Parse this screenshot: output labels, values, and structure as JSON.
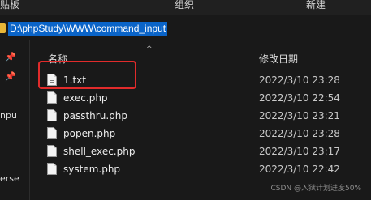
{
  "ribbon": {
    "items": [
      "贴板",
      "组织",
      "新建"
    ]
  },
  "address": {
    "path": "D:\\phpStudy\\WWW\\command_input"
  },
  "nav": {
    "pins": [
      "📌",
      "📌"
    ],
    "labels": [
      "npu",
      "erse"
    ]
  },
  "columns": {
    "name": "名称",
    "modified": "修改日期",
    "sort_arrow": "^"
  },
  "files": [
    {
      "name": "1.txt",
      "modified": "2022/3/10 23:28",
      "type": "txt"
    },
    {
      "name": "exec.php",
      "modified": "2022/3/10 22:54",
      "type": "php"
    },
    {
      "name": "passthru.php",
      "modified": "2022/3/10 23:21",
      "type": "php"
    },
    {
      "name": "popen.php",
      "modified": "2022/3/10 23:28",
      "type": "php"
    },
    {
      "name": "shell_exec.php",
      "modified": "2022/3/10 23:17",
      "type": "php"
    },
    {
      "name": "system.php",
      "modified": "2022/3/10 22:42",
      "type": "php"
    }
  ],
  "watermark": "CSDN @入狱计划进度50%",
  "colors": {
    "selection": "#0a64c8",
    "highlight_box": "#e12b2b",
    "background": "#191919"
  }
}
